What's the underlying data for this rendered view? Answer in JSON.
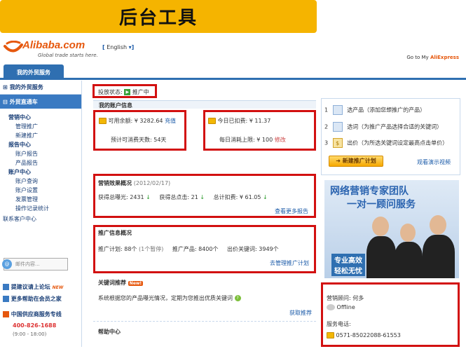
{
  "banner": {
    "title": "后台工具"
  },
  "header": {
    "logo_text": "Alibaba.com",
    "logo_tagline": "Global trade starts here.",
    "language": "English",
    "goto_text": "Go to My",
    "goto_brand": "AliExpress"
  },
  "nav": {
    "tab_label": "我的外贸服务"
  },
  "sidebar": {
    "section1": "我的外贸服务",
    "section2": "外贸直通车",
    "groups": [
      {
        "label": "营销中心",
        "items": [
          "管理推广",
          "新建推广"
        ]
      },
      {
        "label": "报告中心",
        "items": [
          "账户报告",
          "产品报告"
        ]
      },
      {
        "label": "账户中心",
        "items": [
          "账户查询",
          "账户设置",
          "发票管理",
          "操作记录统计"
        ]
      }
    ],
    "contact_label": "联系客户中心",
    "mail_placeholder": "邮件内容...",
    "links": [
      "提建议请上论坛",
      "更多帮助在会员之家",
      "中国供应商服务专线"
    ],
    "new_badge": "NEW",
    "phone": "400-826-1688",
    "hours": "(9:00 - 18:00)"
  },
  "status": {
    "label": "投放状态:",
    "value": "推广中"
  },
  "account": {
    "title": "我的账户信息",
    "balance_label": "可用余额:",
    "balance_value": "¥ 3282.64",
    "recharge": "充值",
    "days_label": "预计可消费天数:",
    "days_value": "54天",
    "today_label": "今日已扣费:",
    "today_value": "¥ 11.37",
    "limit_label": "每日消耗上限:",
    "limit_value": "¥ 100",
    "modify": "修改"
  },
  "effect": {
    "title": "营销效果概况",
    "date": "(2012/02/17)",
    "exposure_label": "获得总曝光:",
    "exposure_value": "2431",
    "clicks_label": "获得总点击:",
    "clicks_value": "21",
    "cost_label": "总计扣费:",
    "cost_value": "¥ 61.05",
    "more": "查看更多报告"
  },
  "promo_info": {
    "title": "推广信息概况",
    "plans_label": "推广计划:",
    "plans_value": "88个",
    "paused": "(1个暂停)",
    "products_label": "推广产品:",
    "products_value": "8400个",
    "keywords_label": "出价关键词:",
    "keywords_value": "3949个",
    "manage": "去管理推广计划"
  },
  "keyword_rec": {
    "title": "关键词推荐",
    "new_badge": "New!",
    "text": "系统根据您的产品曝光情况，定期为您推出优质关键词",
    "action": "获取推荐"
  },
  "help": {
    "title": "帮助中心"
  },
  "steps": {
    "items": [
      {
        "num": "1",
        "text": "选产品（添加您想推广的产品）"
      },
      {
        "num": "2",
        "text": "选词（为推广产品选择合适的关键词）"
      },
      {
        "num": "3",
        "text": "出价（为所选关键词设定最高点击单价）"
      }
    ],
    "button": "新建推广计划",
    "demo": "观看演示视频"
  },
  "promo_banner": {
    "line1": "网络营销专家团队",
    "line2": "一对一顾问服务",
    "tag1": "专业高效",
    "tag2": "轻松无忧"
  },
  "advisor": {
    "label": "营销顾问:",
    "name": "何多",
    "status": "Offline",
    "phone_label": "服务电话:",
    "phone": "0571-85022088-61553"
  },
  "colors": {
    "accent": "#2f6fb1",
    "alert": "#d21010",
    "banner": "#f5b400"
  }
}
